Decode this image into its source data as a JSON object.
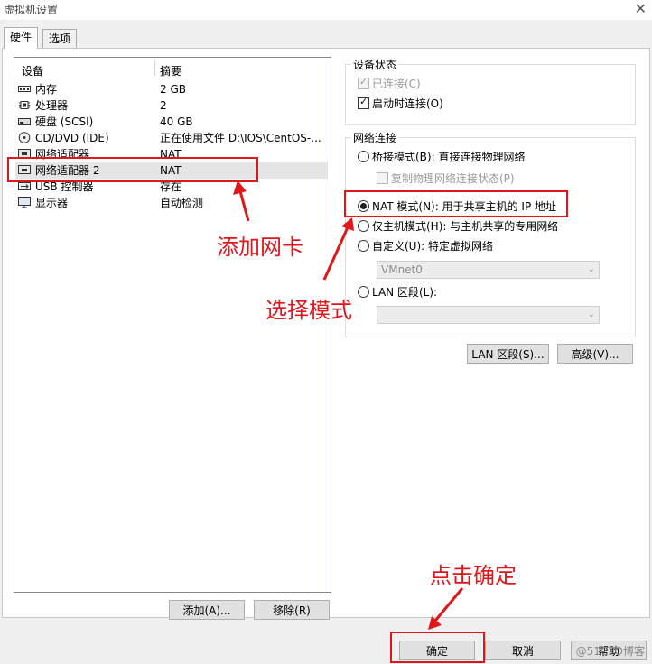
{
  "window": {
    "title": "虚拟机设置",
    "close_glyph": "✕"
  },
  "tabs": [
    {
      "label": "硬件"
    },
    {
      "label": "选项"
    }
  ],
  "device_list": {
    "columns": {
      "device": "设备",
      "summary": "摘要"
    },
    "rows": [
      {
        "icon": "memory-icon",
        "name": "内存",
        "summary": "2 GB"
      },
      {
        "icon": "processor-icon",
        "name": "处理器",
        "summary": "2"
      },
      {
        "icon": "hard-disk-icon",
        "name": "硬盘 (SCSI)",
        "summary": "40 GB"
      },
      {
        "icon": "cd-dvd-icon",
        "name": "CD/DVD (IDE)",
        "summary": "正在使用文件 D:\\IOS\\CentOS-..."
      },
      {
        "icon": "network-adapter-icon",
        "name": "网络适配器",
        "summary": "NAT"
      },
      {
        "icon": "network-adapter-icon",
        "name": "网络适配器 2",
        "summary": "NAT",
        "selected": true
      },
      {
        "icon": "usb-icon",
        "name": "USB 控制器",
        "summary": "存在"
      },
      {
        "icon": "display-icon",
        "name": "显示器",
        "summary": "自动检测"
      }
    ]
  },
  "list_buttons": {
    "add": "添加(A)...",
    "remove": "移除(R)"
  },
  "device_status": {
    "title": "设备状态",
    "connected": {
      "label": "已连接(C)",
      "checked": true,
      "disabled": true
    },
    "connect_at_power_on": {
      "label": "启动时连接(O)",
      "checked": true
    }
  },
  "network_connection": {
    "title": "网络连接",
    "bridged": {
      "label": "桥接模式(B): 直接连接物理网络"
    },
    "replicate": {
      "label": "复制物理网络连接状态(P)"
    },
    "nat": {
      "label": "NAT 模式(N): 用于共享主机的 IP 地址",
      "selected": true
    },
    "host_only": {
      "label": "仅主机模式(H): 与主机共享的专用网络"
    },
    "custom": {
      "label": "自定义(U): 特定虚拟网络"
    },
    "custom_value": "VMnet0",
    "lan_segment": {
      "label": "LAN 区段(L):"
    },
    "lan_segment_value": ""
  },
  "panel_buttons": {
    "lan_segments": "LAN 区段(S)...",
    "advanced": "高级(V)..."
  },
  "dialog_buttons": {
    "ok": "确定",
    "cancel": "取消",
    "help": "帮助"
  },
  "annotations": {
    "add_nic": "添加网卡",
    "select_mode": "选择模式",
    "click_ok": "点击确定",
    "color": "#e0161b"
  },
  "watermark": "@51CTO博客"
}
